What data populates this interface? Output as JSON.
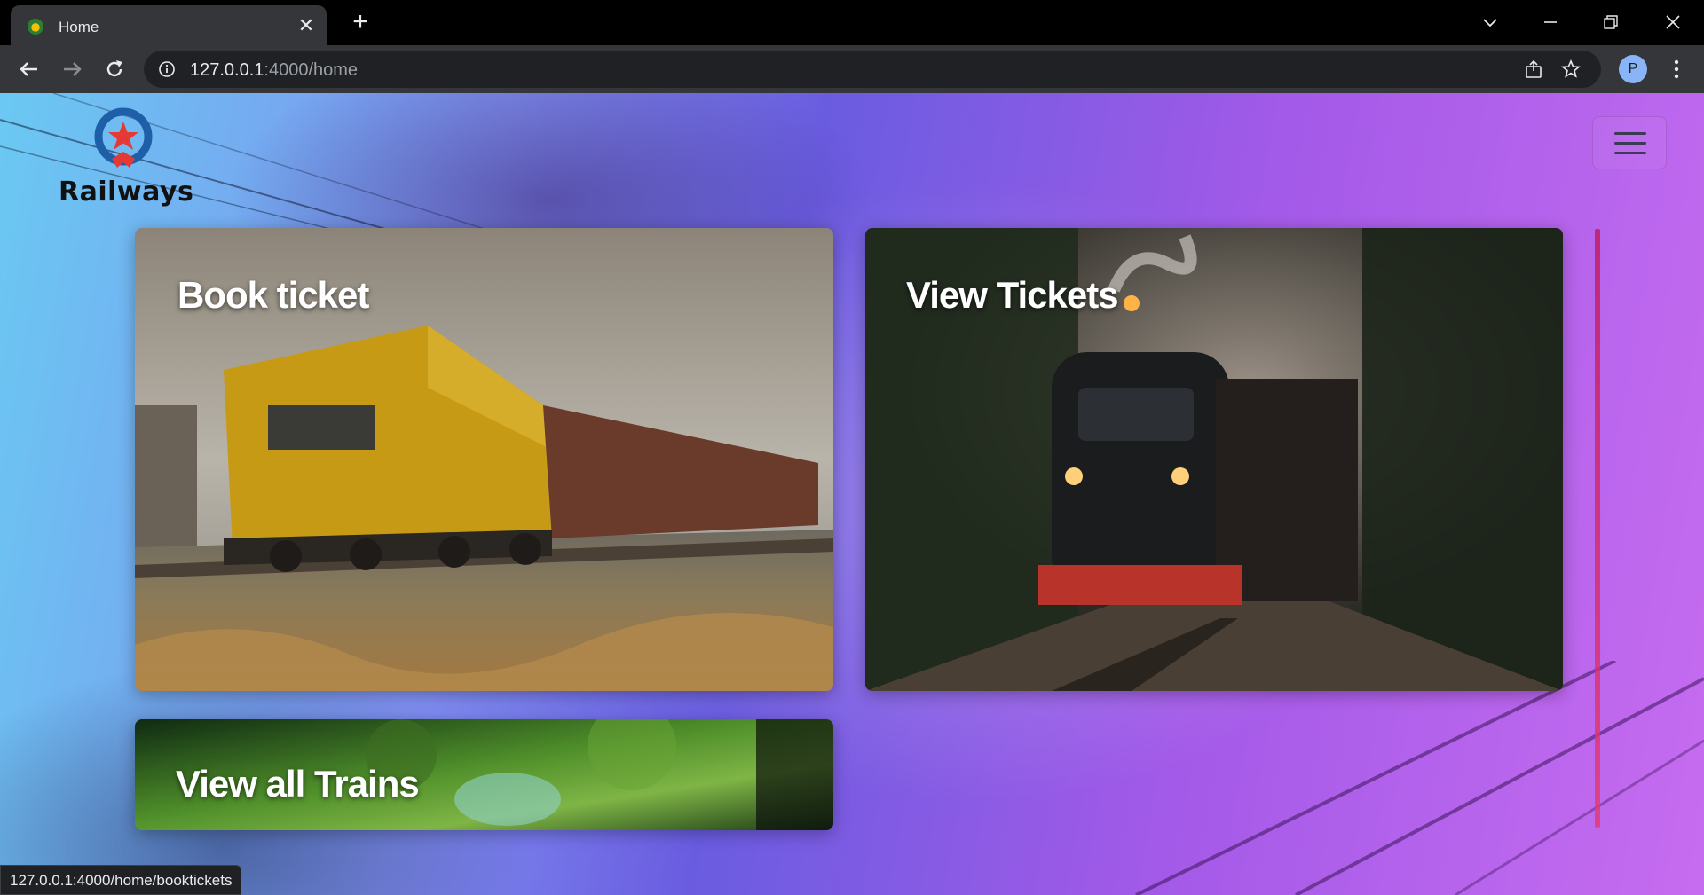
{
  "browser": {
    "tab_title": "Home",
    "url_host": "127.0.0.1",
    "url_path": ":4000/home",
    "profile_initial": "P",
    "status_url": "127.0.0.1:4000/home/booktickets"
  },
  "header": {
    "logo_text": "Railways"
  },
  "cards": {
    "book_ticket": "Book ticket",
    "view_tickets": "View Tickets",
    "view_all_trains": "View all Trains"
  },
  "colors": {
    "accent": "#e53970",
    "logo_star": "#e53935",
    "logo_ring": "#1565c0"
  }
}
